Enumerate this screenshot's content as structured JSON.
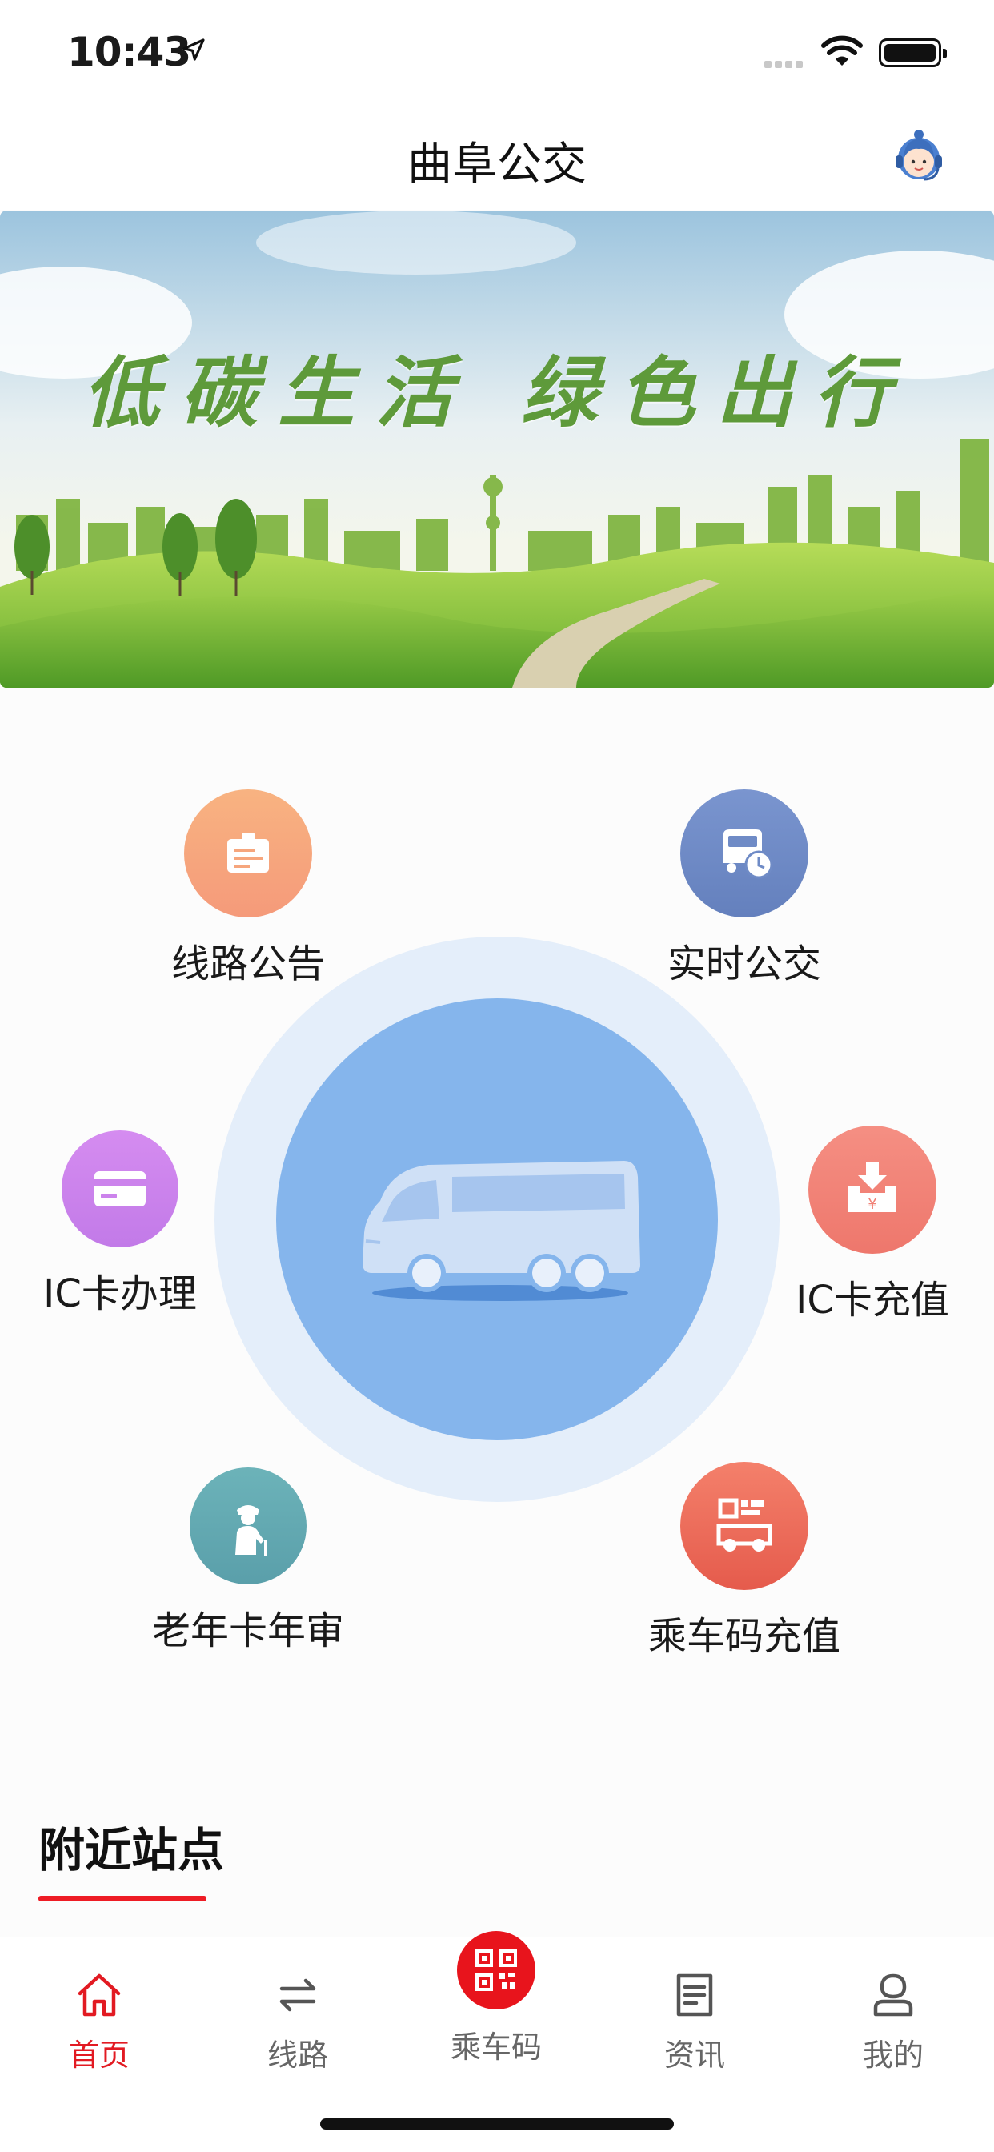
{
  "status_bar": {
    "time": "10:43"
  },
  "header": {
    "title": "曲阜公交",
    "support_icon": "customer-service-icon"
  },
  "banner": {
    "slogan": "低碳生活 绿色出行"
  },
  "services": {
    "notice": {
      "label": "线路公告",
      "icon": "notice-board-icon",
      "color": "#f6a67d"
    },
    "realtime": {
      "label": "实时公交",
      "icon": "bus-clock-icon",
      "color": "#6f8bc6"
    },
    "ic_apply": {
      "label": "IC卡办理",
      "icon": "card-icon",
      "color": "#cc83ec"
    },
    "ic_recharge": {
      "label": "IC卡充值",
      "icon": "recharge-download-icon",
      "color": "#f18277"
    },
    "senior": {
      "label": "老年卡年审",
      "icon": "elderly-person-icon",
      "color": "#62a9b1"
    },
    "qr_recharge": {
      "label": "乘车码充值",
      "icon": "qr-bus-icon",
      "color": "#ea6b5b"
    }
  },
  "hub": {
    "icon": "bus-icon",
    "color": "#85b5ec"
  },
  "nearby": {
    "title": "附近站点"
  },
  "tabs": [
    {
      "label": "首页",
      "icon": "home-icon",
      "active": true
    },
    {
      "label": "线路",
      "icon": "route-swap-icon",
      "active": false
    },
    {
      "label": "乘车码",
      "icon": "qr-code-icon",
      "active": false
    },
    {
      "label": "资讯",
      "icon": "news-icon",
      "active": false
    },
    {
      "label": "我的",
      "icon": "profile-icon",
      "active": false
    }
  ],
  "colors": {
    "accent": "#e21a22",
    "tab_inactive": "#666666"
  }
}
